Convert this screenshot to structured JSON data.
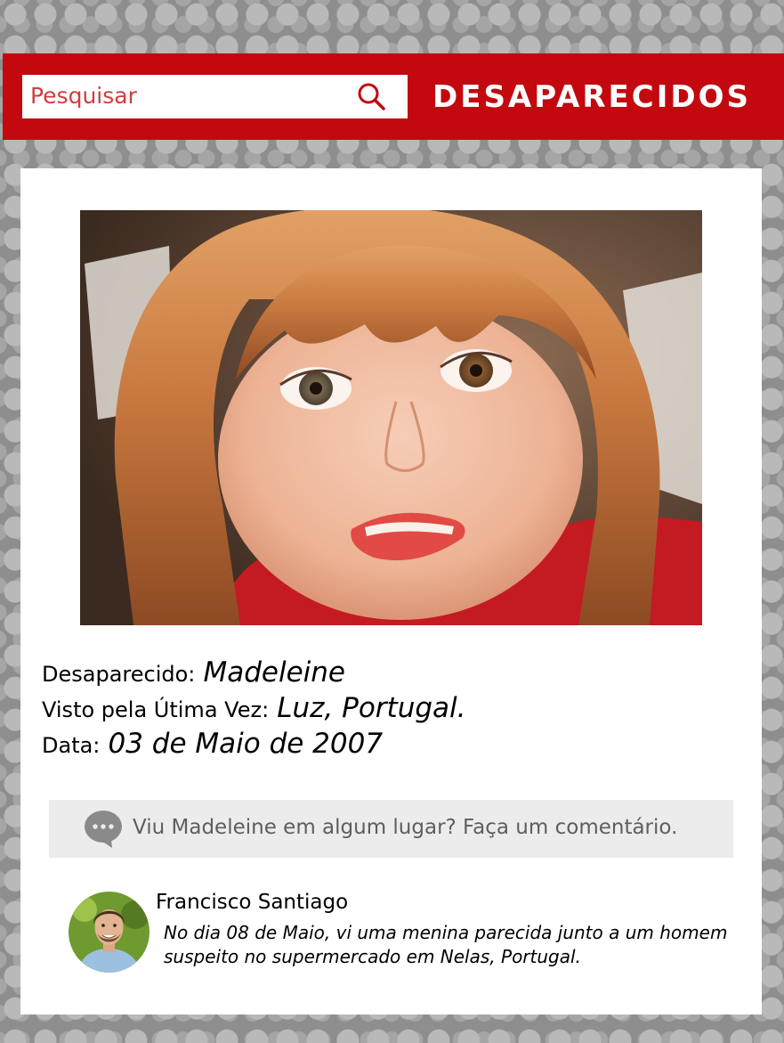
{
  "header": {
    "search_placeholder": "Pesquisar",
    "title": "DESAPARECIDOS",
    "background_color": "#c4080f"
  },
  "profile": {
    "photo_icon": "portrait-photo",
    "missing_label": "Desaparecido:",
    "missing_value": "Madeleine",
    "last_seen_label": "Visto pela Útima Vez:",
    "last_seen_value": "Luz, Portugal.",
    "date_label": "Data:",
    "date_value": "03 de Maio de 2007"
  },
  "comments": {
    "prompt_icon": "chat-bubble-icon",
    "prompt": "Viu Madeleine em algum lugar? Faça um comentário.",
    "items": [
      {
        "author": "Francisco Santiago",
        "avatar_icon": "user-avatar",
        "text": "No dia 08 de Maio, vi uma menina parecida junto a um homem suspeito no supermercado em Nelas, Portugal."
      }
    ]
  }
}
